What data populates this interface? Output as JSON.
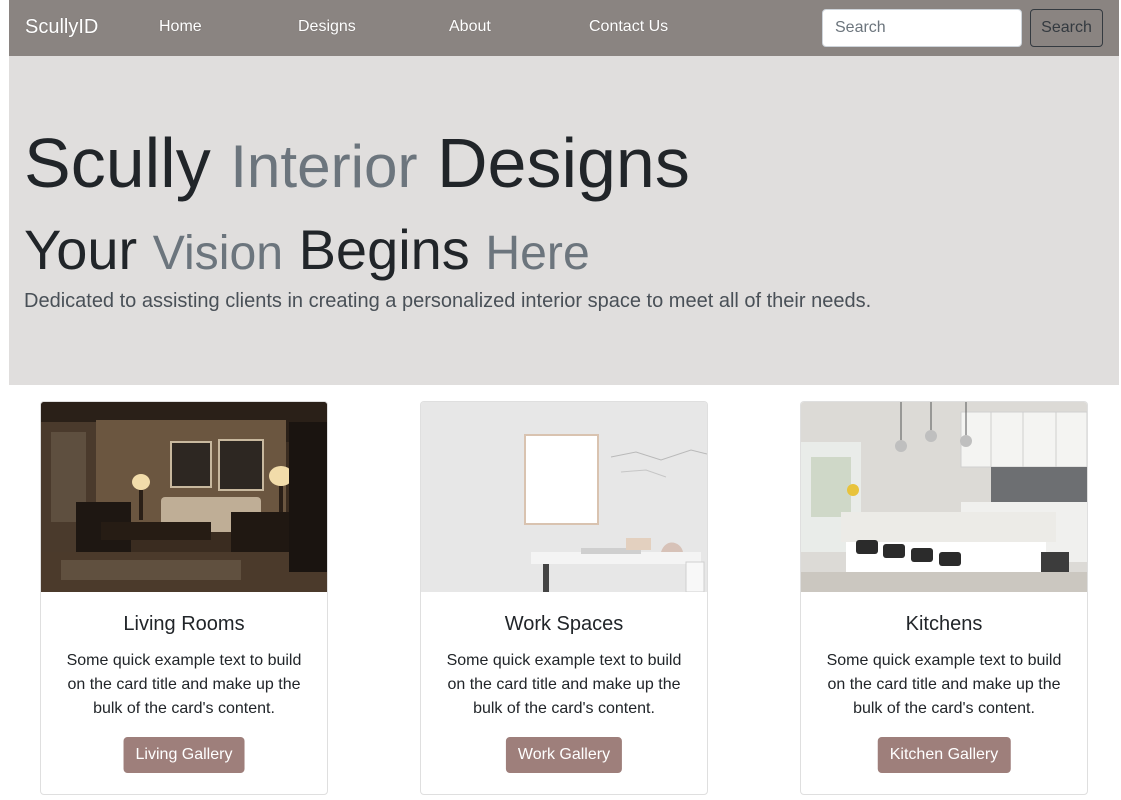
{
  "navbar": {
    "brand": "ScullyID",
    "links": [
      "Home",
      "Designs",
      "About",
      "Contact Us"
    ],
    "search_placeholder": "Search",
    "search_button": "Search"
  },
  "hero": {
    "line1": {
      "part1": "Scully",
      "part2": "Interior",
      "part3": "Designs"
    },
    "line2": {
      "part1": "Your",
      "part2": "Vision",
      "part3": "Begins",
      "part4": "Here"
    },
    "lead": "Dedicated to assisting clients in creating a personalized interior space to meet all of their needs."
  },
  "cards": [
    {
      "title": "Living Rooms",
      "text": "Some quick example text to build on the card title and make up the bulk of the card's content.",
      "button": "Living Gallery"
    },
    {
      "title": "Work Spaces",
      "text": "Some quick example text to build on the card title and make up the bulk of the card's content.",
      "button": "Work Gallery"
    },
    {
      "title": "Kitchens",
      "text": "Some quick example text to build on the card title and make up the bulk of the card's content.",
      "button": "Kitchen Gallery"
    }
  ],
  "colors": {
    "navbar_bg": "#8a8481",
    "hero_bg": "#e0dedd",
    "button_bg": "#9e7f7b"
  }
}
